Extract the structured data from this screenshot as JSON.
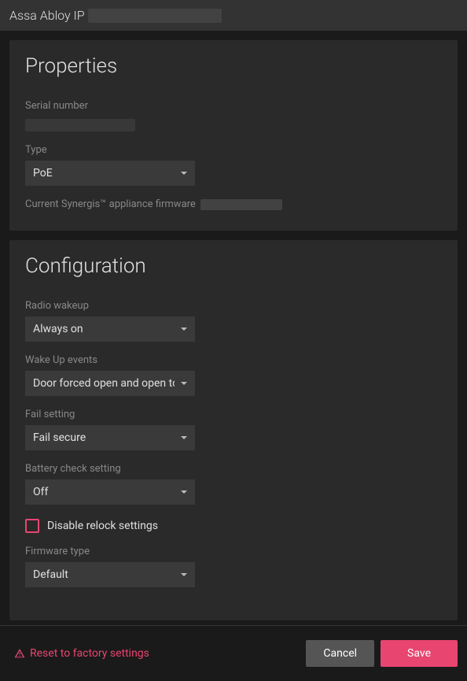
{
  "header": {
    "title": "Assa Abloy IP"
  },
  "properties": {
    "section_title": "Properties",
    "serial_label": "Serial number",
    "type_label": "Type",
    "type_value": "PoE",
    "firmware_label": "Current Synergis™ appliance firmware"
  },
  "configuration": {
    "section_title": "Configuration",
    "radio_wakeup_label": "Radio wakeup",
    "radio_wakeup_value": "Always on",
    "wakeup_events_label": "Wake Up events",
    "wakeup_events_value": "Door forced open and open too long",
    "fail_setting_label": "Fail setting",
    "fail_setting_value": "Fail secure",
    "battery_check_label": "Battery check setting",
    "battery_check_value": "Off",
    "disable_relock_label": "Disable relock settings",
    "firmware_type_label": "Firmware type",
    "firmware_type_value": "Default"
  },
  "footer": {
    "reset_label": "Reset to factory settings",
    "cancel_label": "Cancel",
    "save_label": "Save"
  }
}
